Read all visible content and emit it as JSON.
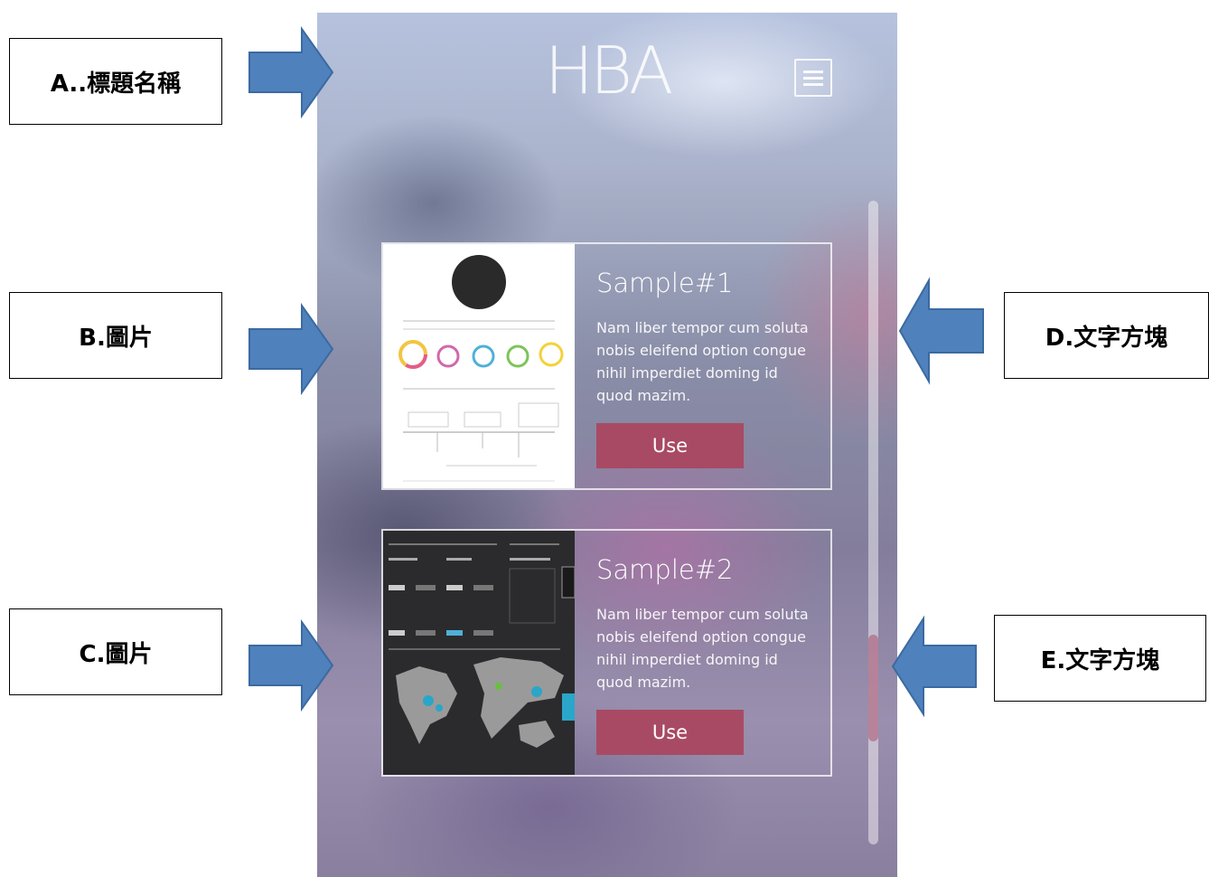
{
  "app": {
    "title": "HBA"
  },
  "cards": [
    {
      "title": "Sample#1",
      "text": "Nam liber tempor cum soluta nobis eleifend option congue nihil imperdiet doming id quod mazim.",
      "button_label": "Use"
    },
    {
      "title": "Sample#2",
      "text": "Nam liber tempor cum soluta nobis eleifend option congue nihil imperdiet doming id quod mazim.",
      "button_label": "Use"
    }
  ],
  "annotations": {
    "a": "A..標題名稱",
    "b": "B.圖片",
    "c": "C.圖片",
    "d": "D.文字方塊",
    "e": "E.文字方塊"
  },
  "colors": {
    "accent_button": "#a84a63",
    "arrow": "#4f81bd"
  },
  "icons": {
    "menu": "list-menu-icon"
  }
}
